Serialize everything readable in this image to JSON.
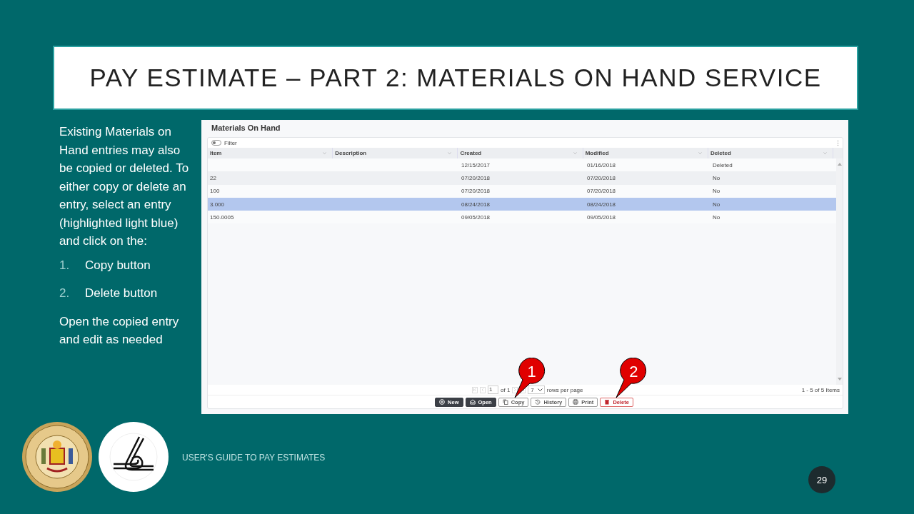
{
  "slide": {
    "title": "PAY ESTIMATE – PART 2: MATERIALS ON HAND SERVICE",
    "intro": "Existing Materials on Hand entries may also be copied or deleted. To either copy or delete an entry, select an entry (highlighted light blue) and click on the:",
    "steps": [
      {
        "number": "1.",
        "text": "Copy button"
      },
      {
        "number": "2.",
        "text": "Delete button"
      }
    ],
    "outro": "Open the copied entry and edit as needed"
  },
  "app": {
    "title": "Materials On Hand",
    "filter": {
      "label": "Filter",
      "on": false
    },
    "columns": [
      "Item",
      "Description",
      "Created",
      "Modified",
      "Deleted"
    ],
    "rows": [
      {
        "cells": [
          "",
          "",
          "12/15/2017",
          "01/16/2018",
          "Deleted"
        ],
        "selected": false
      },
      {
        "cells": [
          "22",
          "",
          "07/20/2018",
          "07/20/2018",
          "No"
        ],
        "selected": false
      },
      {
        "cells": [
          "100",
          "",
          "07/20/2018",
          "07/20/2018",
          "No"
        ],
        "selected": false
      },
      {
        "cells": [
          "3.000",
          "",
          "08/24/2018",
          "08/24/2018",
          "No"
        ],
        "selected": true
      },
      {
        "cells": [
          "150.0005",
          "",
          "09/05/2018",
          "09/05/2018",
          "No"
        ],
        "selected": false
      }
    ],
    "pager": {
      "page": "1",
      "of": "of 1",
      "rows_per_page": "7",
      "rows_label": "rows per page",
      "summary": "1 - 5 of 5 Items"
    },
    "buttons": [
      {
        "label": "New",
        "kind": "dark"
      },
      {
        "label": "Open",
        "kind": "dark"
      },
      {
        "label": "Copy",
        "kind": "outline",
        "callout": "1"
      },
      {
        "label": "History",
        "kind": "outline"
      },
      {
        "label": "Print",
        "kind": "outline"
      },
      {
        "label": "Delete",
        "kind": "danger",
        "callout": "2"
      }
    ]
  },
  "footer": {
    "text": "USER'S GUIDE TO PAY ESTIMATES",
    "page_number": "29"
  }
}
